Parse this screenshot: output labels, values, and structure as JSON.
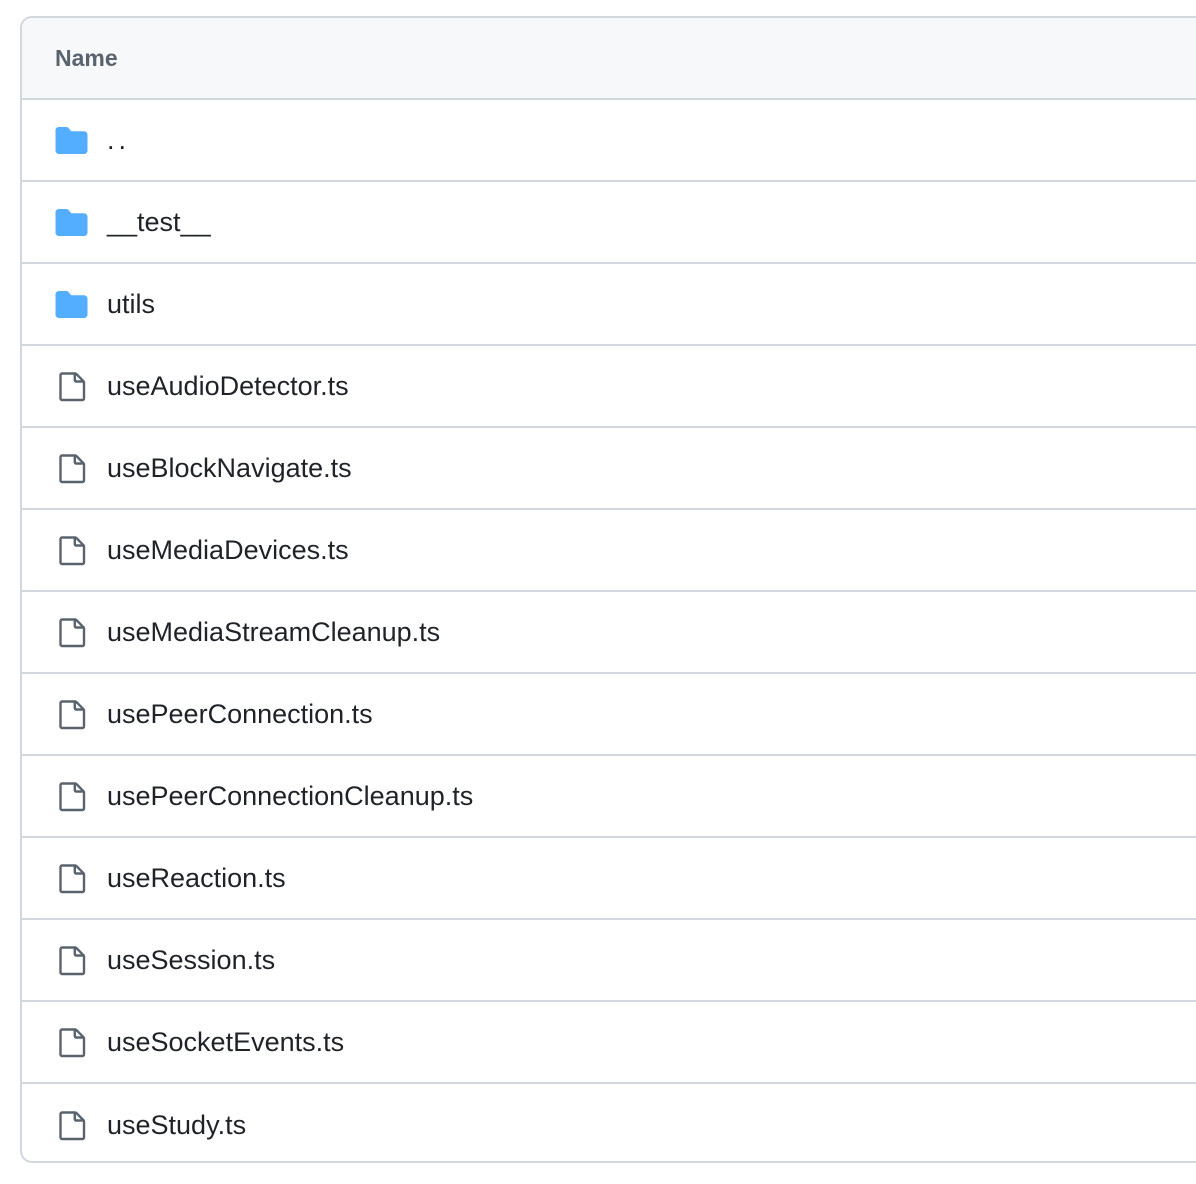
{
  "colors": {
    "folder": "#54aeff",
    "file_icon": "#59636e",
    "border": "#d0d7de",
    "header_bg": "#f6f8fa"
  },
  "header": {
    "name_label": "Name"
  },
  "rows": [
    {
      "type": "folder",
      "icon": "folder-icon",
      "label": ".."
    },
    {
      "type": "folder",
      "icon": "folder-icon",
      "label": "__test__"
    },
    {
      "type": "folder",
      "icon": "folder-icon",
      "label": "utils"
    },
    {
      "type": "file",
      "icon": "file-icon",
      "label": "useAudioDetector.ts"
    },
    {
      "type": "file",
      "icon": "file-icon",
      "label": "useBlockNavigate.ts"
    },
    {
      "type": "file",
      "icon": "file-icon",
      "label": "useMediaDevices.ts"
    },
    {
      "type": "file",
      "icon": "file-icon",
      "label": "useMediaStreamCleanup.ts"
    },
    {
      "type": "file",
      "icon": "file-icon",
      "label": "usePeerConnection.ts"
    },
    {
      "type": "file",
      "icon": "file-icon",
      "label": "usePeerConnectionCleanup.ts"
    },
    {
      "type": "file",
      "icon": "file-icon",
      "label": "useReaction.ts"
    },
    {
      "type": "file",
      "icon": "file-icon",
      "label": "useSession.ts"
    },
    {
      "type": "file",
      "icon": "file-icon",
      "label": "useSocketEvents.ts"
    },
    {
      "type": "file",
      "icon": "file-icon",
      "label": "useStudy.ts"
    }
  ]
}
